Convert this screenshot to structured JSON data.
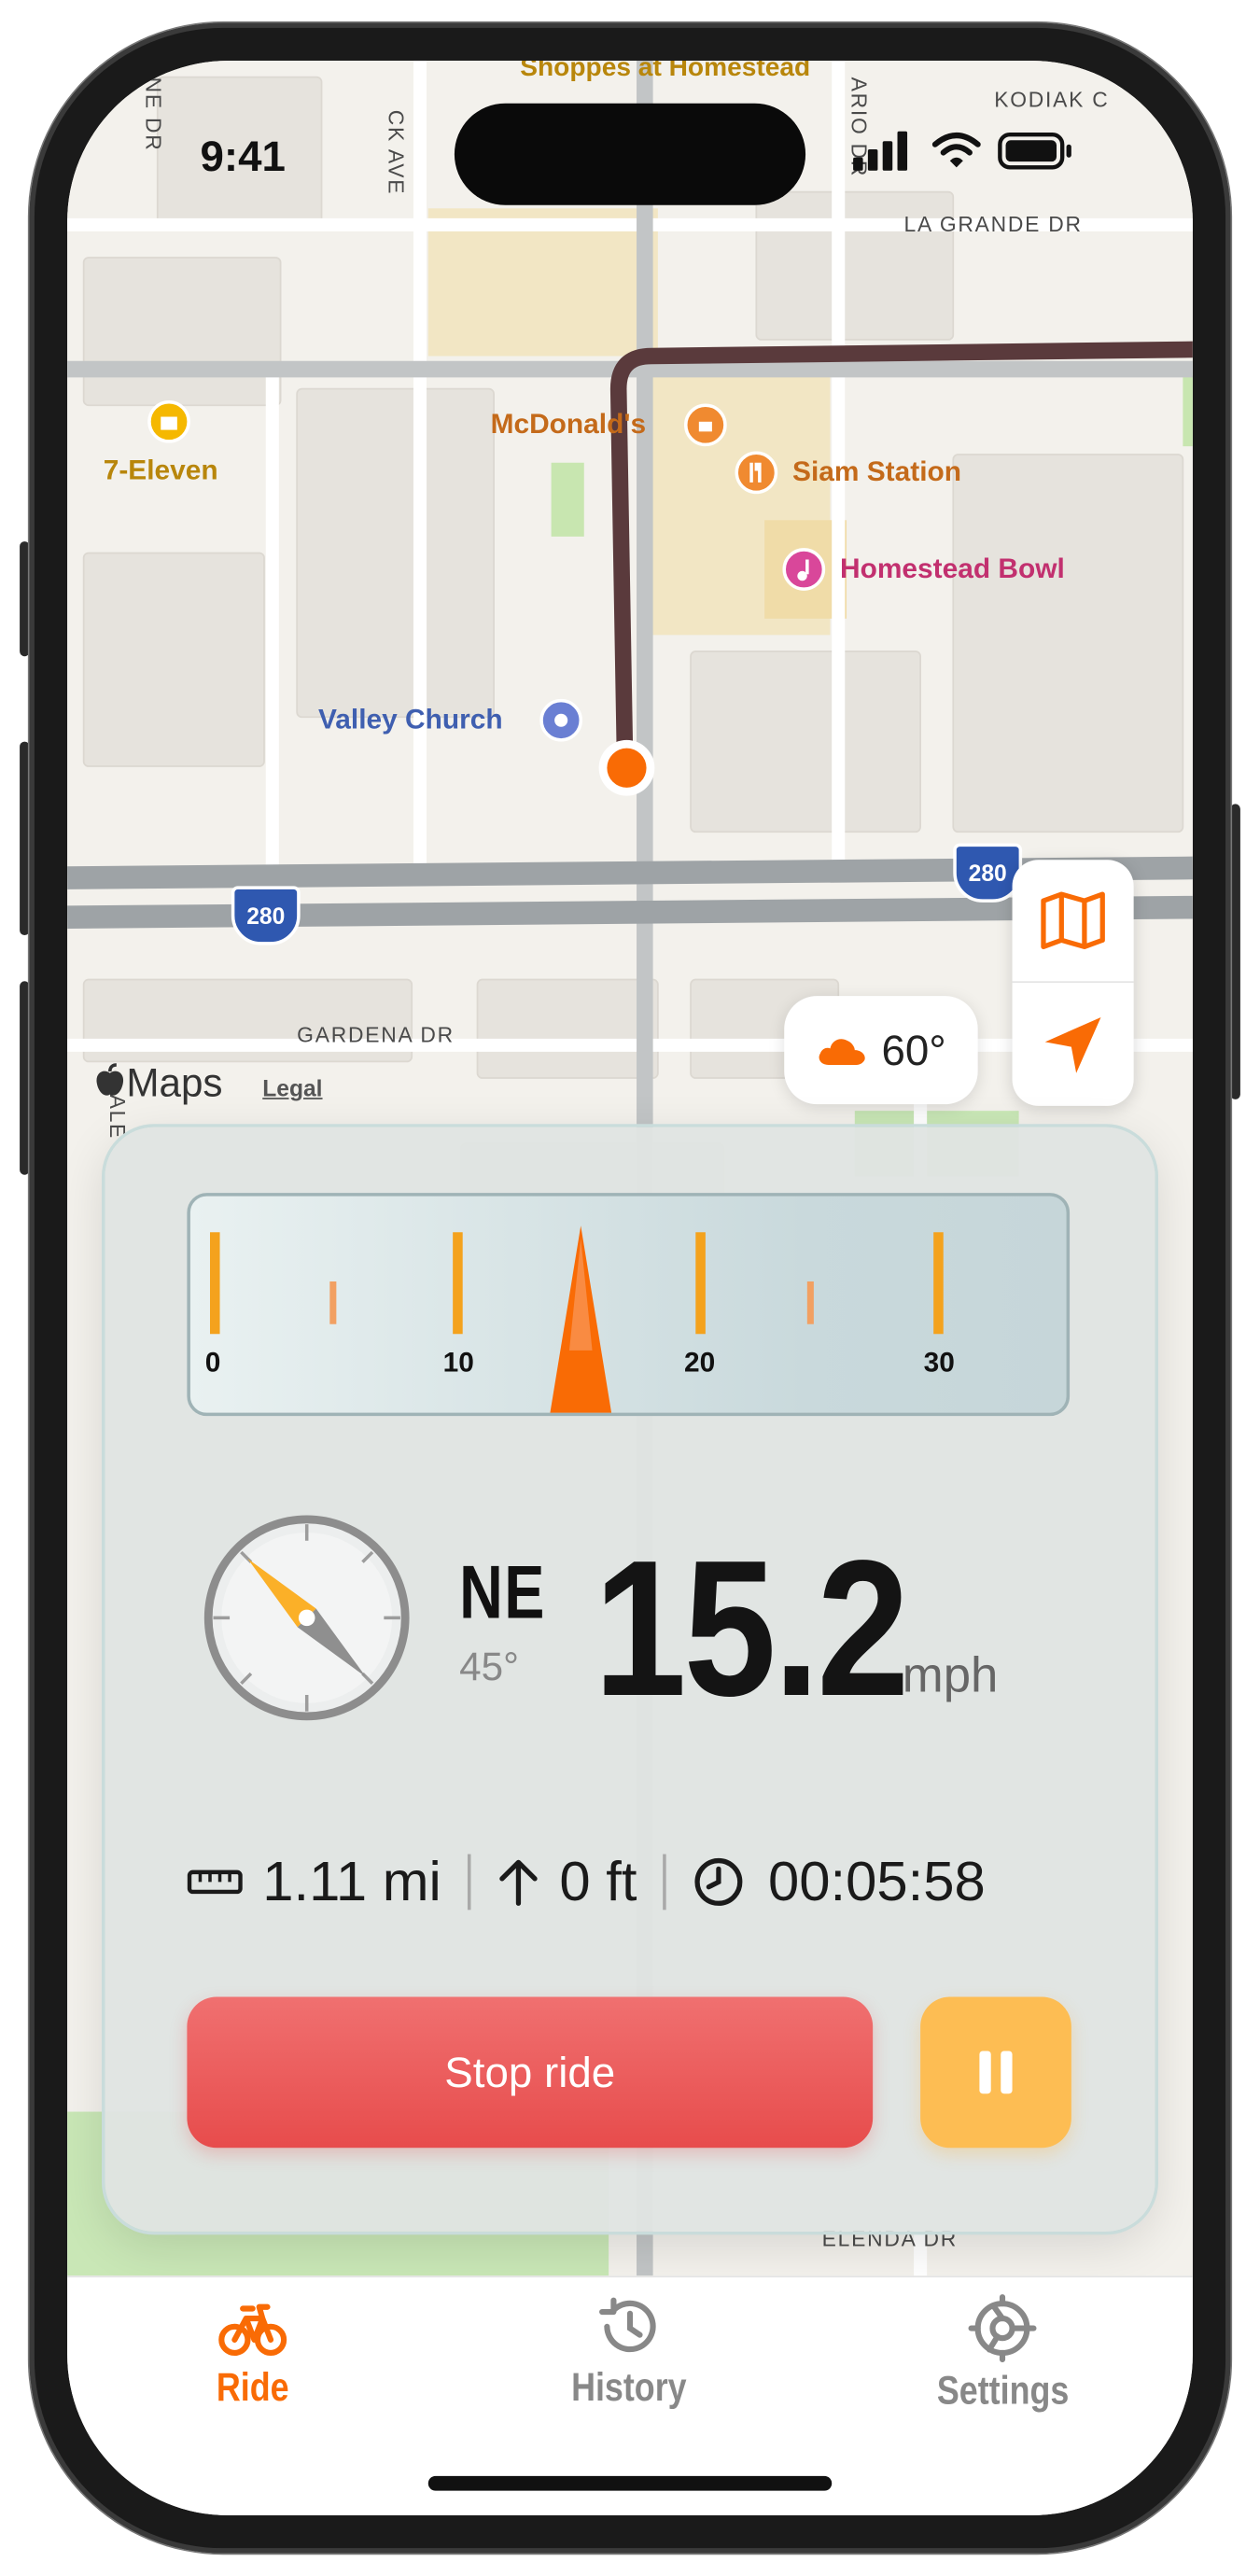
{
  "status_bar": {
    "time": "9:41"
  },
  "map": {
    "streets": [
      "LA GRANDE DR",
      "KODIAK C",
      "GARDENA DR",
      "ELENDA DR",
      "CK AVE",
      "ARIO DR",
      "NE DR",
      "ALE"
    ],
    "pois": [
      {
        "name": "7-Eleven",
        "color": "#b8860b"
      },
      {
        "name": "McDonald's",
        "color": "#c46a1a"
      },
      {
        "name": "Siam Station",
        "color": "#c46a1a"
      },
      {
        "name": "Homestead Bowl",
        "color": "#c2306f"
      },
      {
        "name": "Valley Church",
        "color": "#3f5fb0"
      },
      {
        "name": "Shoppes at Homestead",
        "color": "#b8860b"
      }
    ],
    "highway_shield": "280",
    "attribution": "Maps",
    "legal": "Legal",
    "route_color": "#5a3a3c",
    "position_color": "#f96b05"
  },
  "weather": {
    "temp": "60°",
    "icon": "cloud-icon"
  },
  "speed_gauge": {
    "ticks": [
      "0",
      "10",
      "20",
      "30"
    ],
    "needle_value": 15.2,
    "max": 30
  },
  "heading": {
    "direction": "NE",
    "degrees": "45°",
    "angle": 45
  },
  "speed": {
    "value": "15.2",
    "unit": "mph"
  },
  "stats": {
    "distance": "1.11 mi",
    "elevation": "0 ft",
    "duration": "00:05:58"
  },
  "controls": {
    "stop_label": "Stop ride"
  },
  "tabs": [
    {
      "label": "Ride",
      "icon": "bicycle-icon",
      "active": true
    },
    {
      "label": "History",
      "icon": "history-icon",
      "active": false
    },
    {
      "label": "Settings",
      "icon": "gear-icon",
      "active": false
    }
  ],
  "colors": {
    "accent": "#f96b05",
    "stop": "#e74c4c",
    "pause": "#fdbd53",
    "inactive_tab": "#888888"
  }
}
